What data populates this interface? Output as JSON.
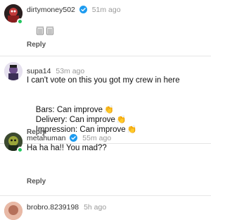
{
  "comments": [
    {
      "username": "dirtymoney502",
      "time": "51m ago",
      "verified": true,
      "online": true,
      "text_icons": [
        "wastebasket-icon",
        "wastebasket-icon"
      ],
      "reply_label": "Reply"
    },
    {
      "username": "supa14",
      "time": "53m ago",
      "verified": false,
      "online": false,
      "lines": [
        "I can't vote on this you got my crew in here",
        "",
        "Bars: Can improve",
        "Delivery: Can improve",
        "Impression: Can improve"
      ],
      "clap_emoji": "👏",
      "reply_label": "Reply"
    },
    {
      "username": "metahuman",
      "time": "55m ago",
      "verified": true,
      "online": true,
      "text": "Ha ha ha!! You mad??",
      "reply_label": "Reply"
    },
    {
      "username": "brobro.8239198",
      "time": "5h ago",
      "verified": false,
      "online": false
    }
  ],
  "colors": {
    "verified_blue": "#1d9bf0",
    "online_green": "#22c55e"
  }
}
